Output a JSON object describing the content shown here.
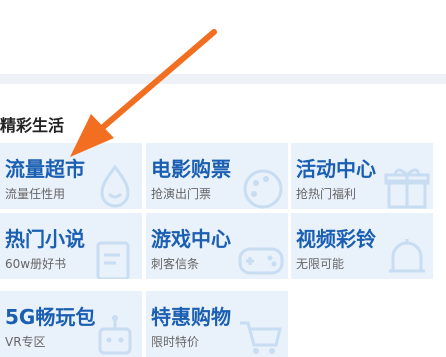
{
  "section": {
    "title": "精彩生活"
  },
  "tiles": [
    {
      "title": "流量超市",
      "subtitle": "流量任性用",
      "icon": "drop-icon"
    },
    {
      "title": "电影购票",
      "subtitle": "抢演出门票",
      "icon": "palette-icon"
    },
    {
      "title": "活动中心",
      "subtitle": "抢热门福利",
      "icon": "gift-icon"
    },
    {
      "title": "热门小说",
      "subtitle": "60w册好书",
      "icon": "book-icon"
    },
    {
      "title": "游戏中心",
      "subtitle": "刺客信条",
      "icon": "gamepad-icon"
    },
    {
      "title": "视频彩铃",
      "subtitle": "无限可能",
      "icon": "bell-icon"
    },
    {
      "title": "5G畅玩包",
      "subtitle": "VR专区",
      "icon": "robot-icon"
    },
    {
      "title": "特惠购物",
      "subtitle": "限时特价",
      "icon": "cart-icon"
    }
  ],
  "colors": {
    "tile_bg": "#e9f1fb",
    "title": "#1b5fb2",
    "arrow": "#f26f21"
  }
}
